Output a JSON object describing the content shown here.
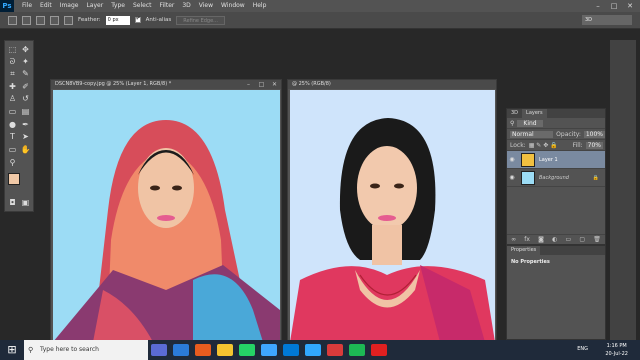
{
  "app": {
    "logo": "Ps",
    "menus": [
      "File",
      "Edit",
      "Image",
      "Layer",
      "Type",
      "Select",
      "Filter",
      "3D",
      "View",
      "Window",
      "Help"
    ],
    "win_controls": [
      "–",
      "□",
      "✕"
    ]
  },
  "options": {
    "feather_label": "Feather:",
    "feather_value": "0 px",
    "antialias_label": "Anti-alias",
    "refine_button": "Refine Edge...",
    "workspace": "3D"
  },
  "doc1": {
    "title": "DSCN8VB9-copy.jpg @ 25% (Layer 1, RGB/8) *",
    "bg": "#9cdcf5"
  },
  "doc2": {
    "title": "@ 25% (RGB/8)",
    "bg": "#cfe4fb"
  },
  "layers": {
    "tabs": [
      "3D",
      "Layers"
    ],
    "kind_label": "Kind",
    "blend_mode": "Normal",
    "opacity_label": "Opacity:",
    "opacity_value": "100%",
    "lock_label": "Lock:",
    "fill_label": "Fill:",
    "fill_value": "70%",
    "items": [
      {
        "name": "Layer 1"
      },
      {
        "name": "Background"
      }
    ]
  },
  "properties": {
    "title": "Properties",
    "body": "No Properties"
  },
  "taskbar": {
    "search_placeholder": "Type here to search",
    "time": "1:16 PM",
    "date": "20-Jul-22",
    "lang": "ENG"
  },
  "icons": [
    "marquee-icon",
    "move-icon",
    "lasso-icon",
    "magic-wand-icon",
    "crop-icon",
    "eyedropper-icon",
    "healing-icon",
    "brush-icon",
    "stamp-icon",
    "history-icon",
    "eraser-icon",
    "gradient-icon",
    "dodge-icon",
    "pen-icon",
    "type-icon",
    "path-select-icon",
    "shape-icon",
    "hand-icon",
    "zoom-icon"
  ],
  "colors": {
    "foreground": "#f1c9a7",
    "background": "#5bc6ea",
    "accent": "#31a8ff"
  }
}
